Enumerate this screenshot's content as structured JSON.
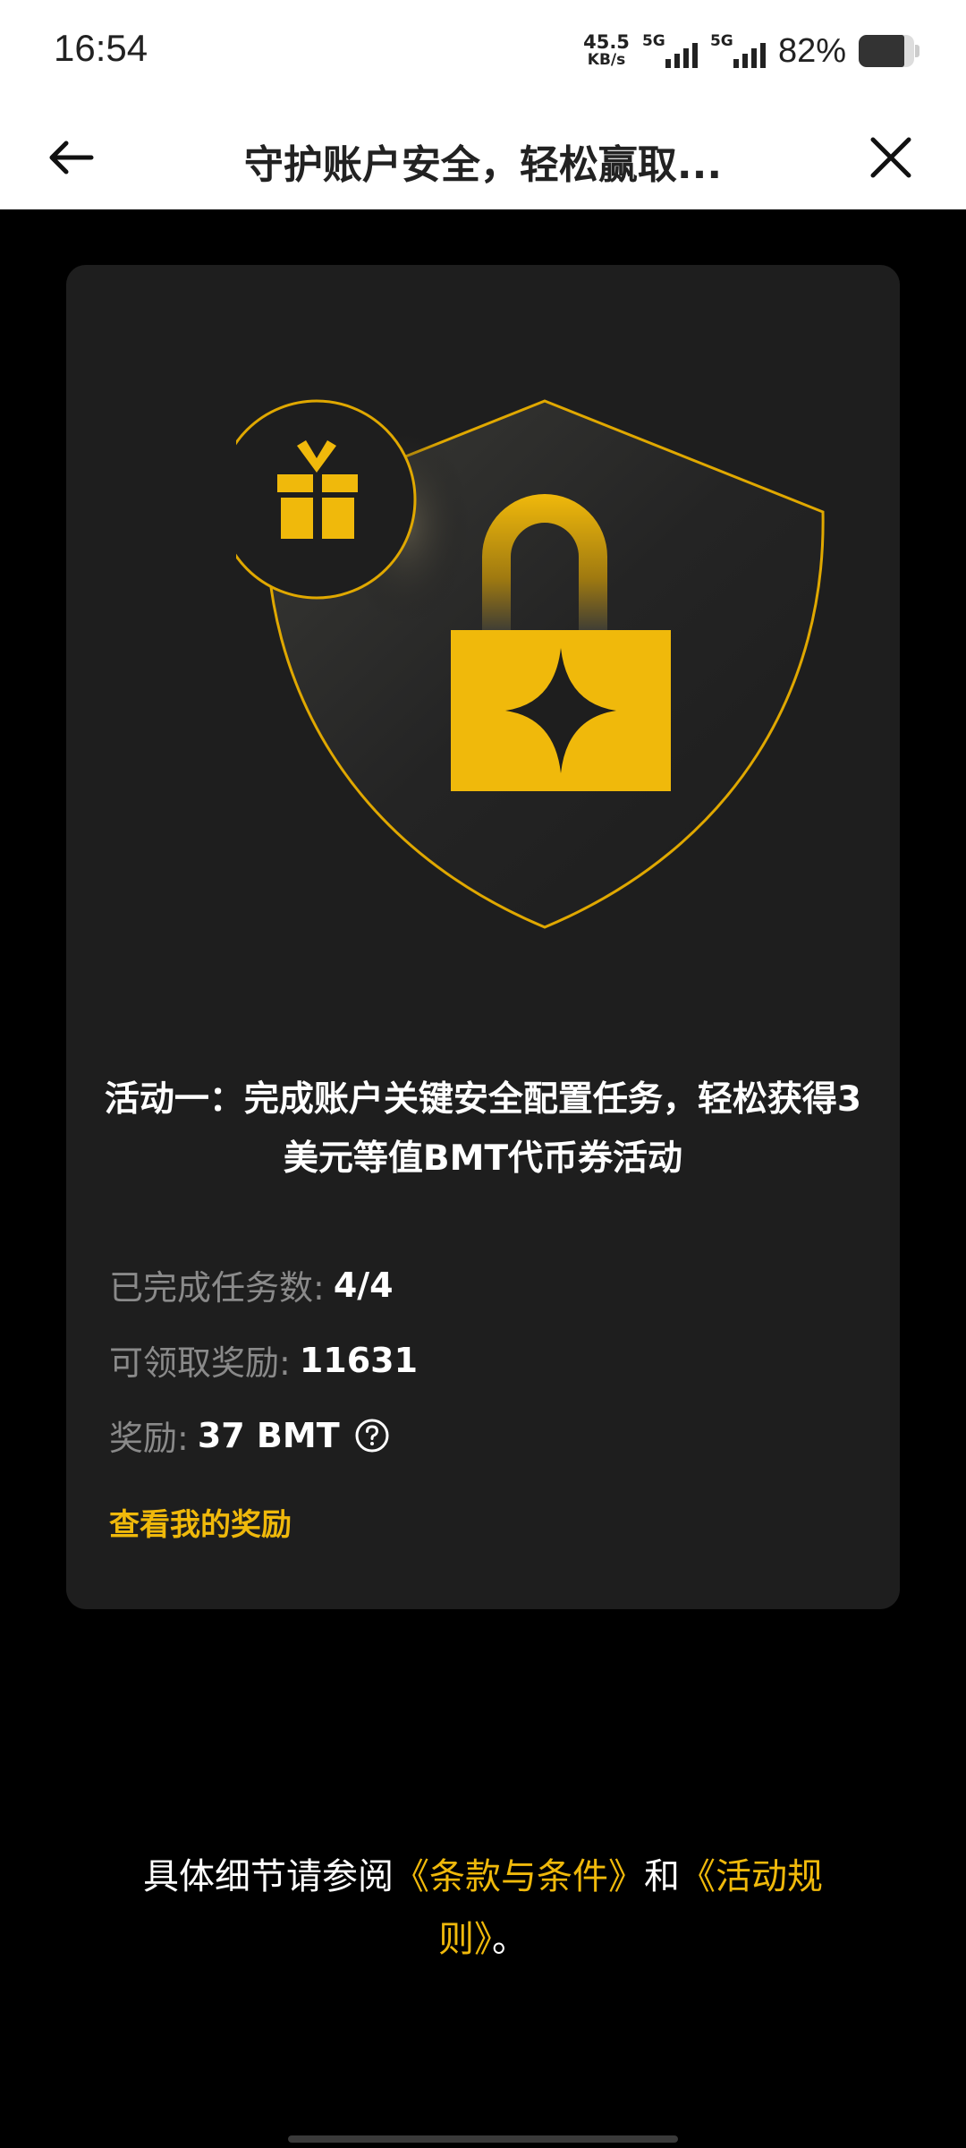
{
  "status": {
    "time": "16:54",
    "net_speed_value": "45.5",
    "net_speed_unit": "KB/s",
    "sim1_label": "5G",
    "sim2_label": "5G",
    "battery_percent": "82%",
    "battery_level": 0.82
  },
  "navbar": {
    "title": "守护账户安全，轻松赢取..."
  },
  "card": {
    "title": "活动一：完成账户关键安全配置任务，轻松获得3美元等值BMT代币券活动",
    "tasks_label": "已完成任务数:",
    "tasks_value": "4/4",
    "claimable_label": "可领取奖励:",
    "claimable_value": "11631",
    "reward_label": "奖励:",
    "reward_value": "37 BMT",
    "view_rewards_link": "查看我的奖励"
  },
  "footer": {
    "prefix": "具体细节请参阅",
    "terms_link": "《条款与条件》",
    "conjunction": "和",
    "rules_link": "《活动规则》",
    "suffix": "。"
  },
  "colors": {
    "accent": "#f0b90b",
    "card_bg": "#1e1e1e",
    "page_bg": "#000000"
  },
  "icons": {
    "back": "arrow-left-icon",
    "close": "close-icon",
    "help": "question-circle-icon",
    "illustration": "shield-lock-gift-illustration"
  }
}
